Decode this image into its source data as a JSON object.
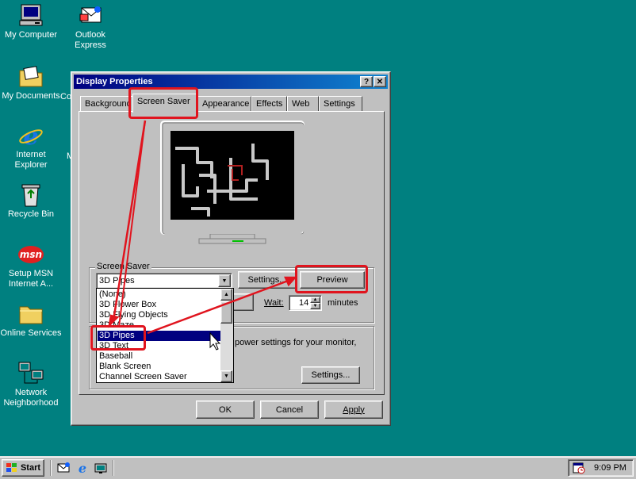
{
  "desktop": {
    "icons": [
      {
        "name": "my-computer",
        "label": "My Computer"
      },
      {
        "name": "outlook-express",
        "label": "Outlook Express"
      },
      {
        "name": "my-documents",
        "label": "My Documents"
      },
      {
        "name": "internet-explorer",
        "label": "Internet Explorer"
      },
      {
        "name": "recycle-bin",
        "label": "Recycle Bin"
      },
      {
        "name": "setup-msn",
        "label": "Setup MSN Internet A..."
      },
      {
        "name": "online-services",
        "label": "Online Services"
      },
      {
        "name": "network-neighborhood",
        "label": "Network Neighborhood"
      }
    ],
    "partial_labels": [
      "Co",
      "M"
    ],
    "colors": {
      "background": "#008080",
      "annotation": "#e0141e",
      "title_bar": "#000080"
    }
  },
  "window": {
    "title": "Display Properties",
    "help_button": "?",
    "close_button": "✕",
    "tabs": [
      {
        "label": "Background"
      },
      {
        "label": "Screen Saver",
        "active": true
      },
      {
        "label": "Appearance"
      },
      {
        "label": "Effects"
      },
      {
        "label": "Web"
      },
      {
        "label": "Settings"
      }
    ],
    "screen_saver": {
      "group_label": "Screen Saver",
      "selected_value": "3D Pipes",
      "settings_button": "Settings...",
      "preview_button": "Preview",
      "wait_label": "Wait:",
      "wait_value": "14",
      "minutes_label": "minutes",
      "options": [
        "(None)",
        "3D Flower Box",
        "3D Flying Objects",
        "3D Maze",
        "3D Pipes",
        "3D Text",
        "Baseball",
        "Blank Screen",
        "Channel Screen Saver"
      ],
      "selected_index": 4
    },
    "energy": {
      "text": "power settings for your monitor,",
      "settings_button": "Settings..."
    },
    "buttons": {
      "ok": "OK",
      "cancel": "Cancel",
      "apply": "Apply"
    }
  },
  "taskbar": {
    "start_label": "Start",
    "quick_launch": [
      "outlook-express-icon",
      "internet-explorer-icon",
      "show-desktop-icon"
    ],
    "clock": "9:09 PM"
  }
}
